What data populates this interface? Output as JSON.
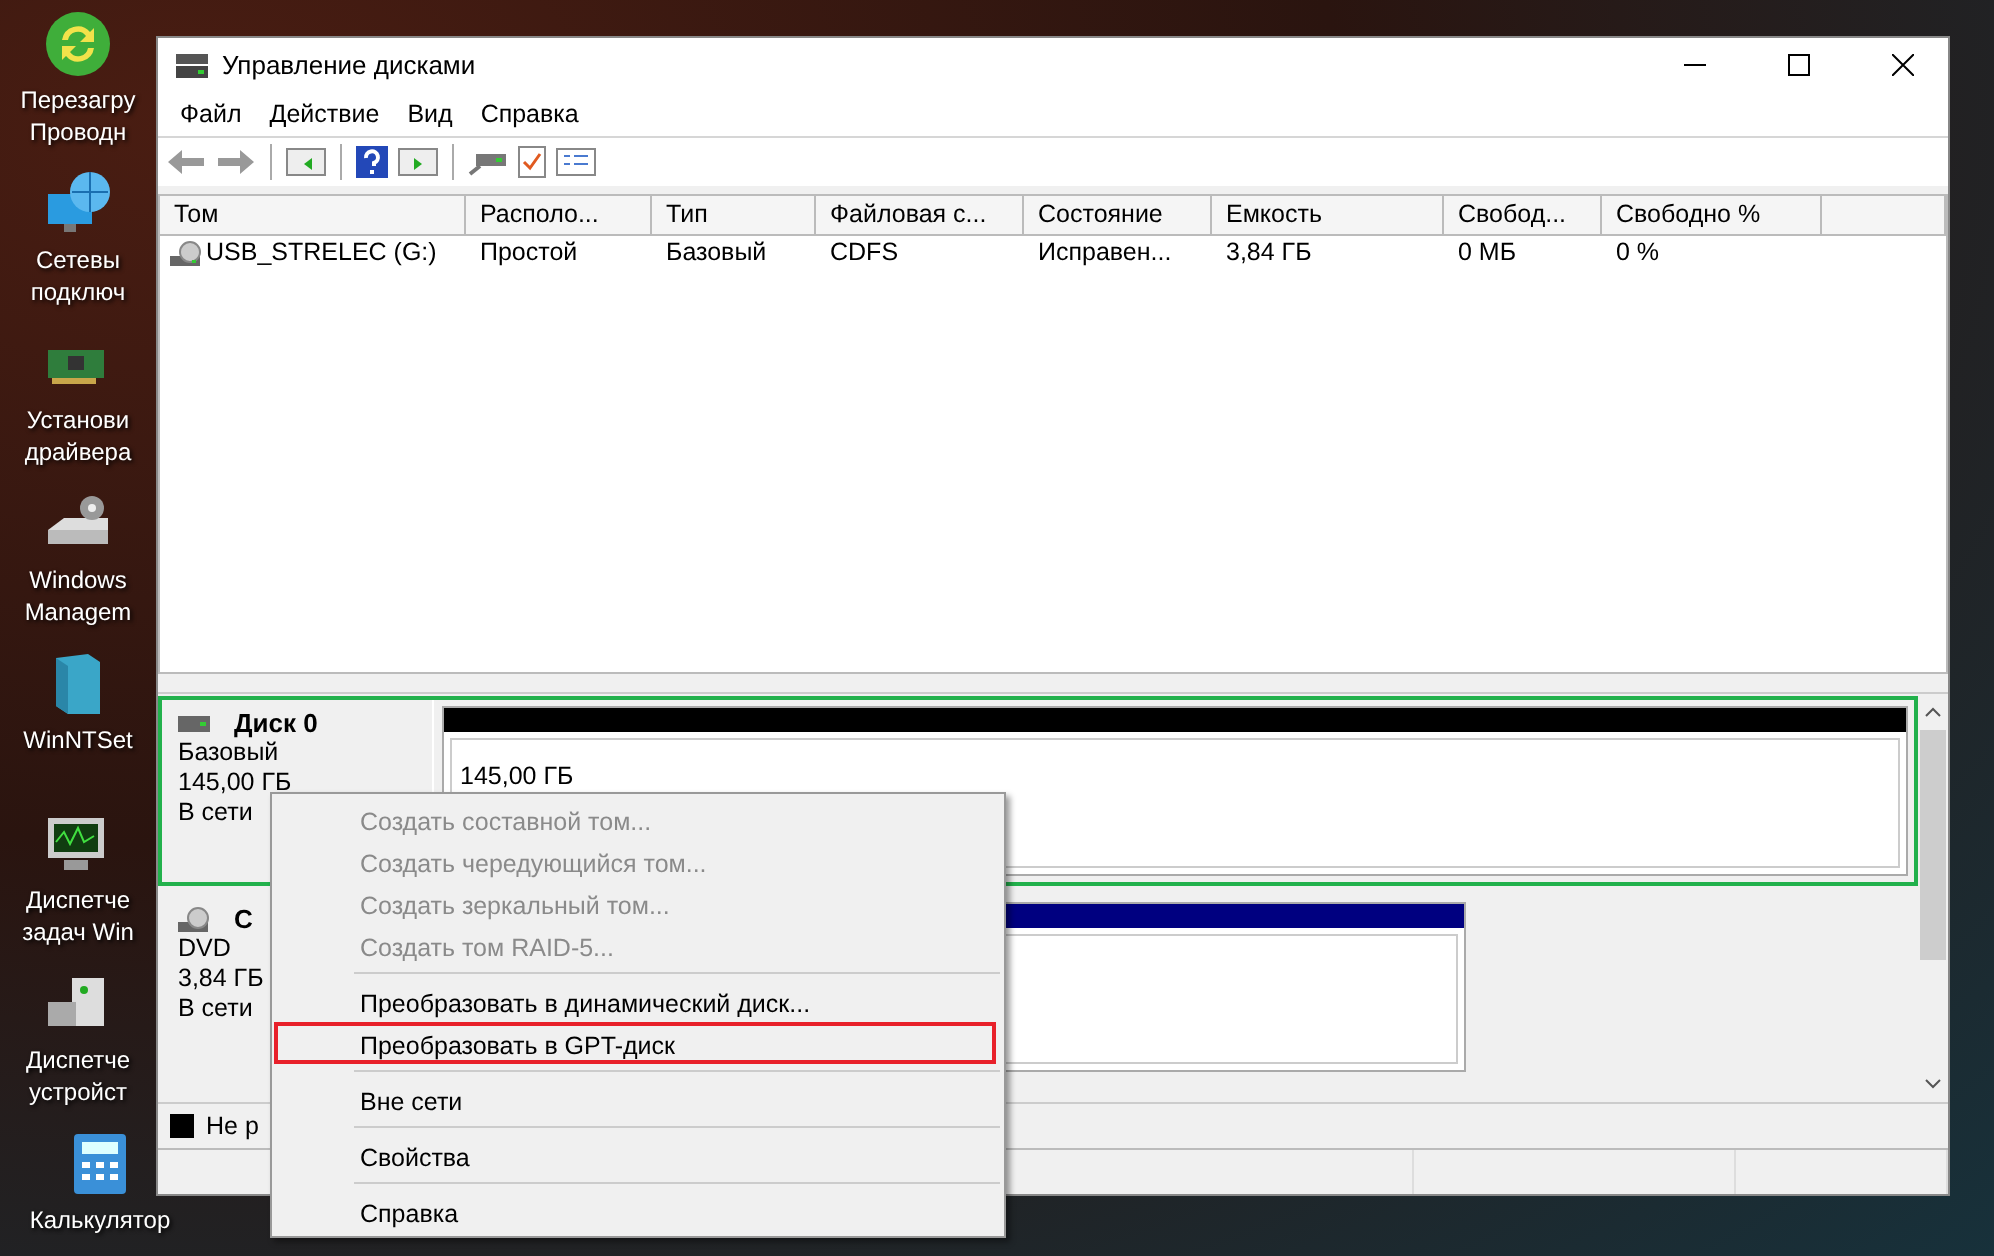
{
  "desktop_icons": [
    {
      "kind": "refresh",
      "label": "Перезагру\nПроводн"
    },
    {
      "kind": "network",
      "label": "Сетевы\nподключ"
    },
    {
      "kind": "board",
      "label": "Установи\nдрайвера"
    },
    {
      "kind": "drive",
      "label": "Windows\nManagem"
    },
    {
      "kind": "box",
      "label": "WinNTSet"
    },
    {
      "kind": "monitor",
      "label": "Диспетче\nзадач Win"
    },
    {
      "kind": "device",
      "label": "Диспетче\nустройст"
    },
    {
      "kind": "calc",
      "label": "Калькулятор"
    }
  ],
  "window": {
    "title": "Управление дисками"
  },
  "menu_bar": [
    "Файл",
    "Действие",
    "Вид",
    "Справка"
  ],
  "toolbar": [
    {
      "kind": "back"
    },
    {
      "kind": "forward"
    },
    {
      "kind": "sep"
    },
    {
      "kind": "panel"
    },
    {
      "kind": "sep"
    },
    {
      "kind": "help"
    },
    {
      "kind": "play"
    },
    {
      "kind": "sep"
    },
    {
      "kind": "connect"
    },
    {
      "kind": "check"
    },
    {
      "kind": "list"
    }
  ],
  "table": {
    "columns": [
      "Том",
      "Располо...",
      "Тип",
      "Файловая с...",
      "Состояние",
      "Емкость",
      "Свобод...",
      "Свободно %"
    ],
    "rows": [
      [
        "USB_STRELEC (G:)",
        "Простой",
        "Базовый",
        "CDFS",
        "Исправен...",
        "3,84 ГБ",
        "0 МБ",
        "0 %"
      ]
    ]
  },
  "disks": [
    {
      "kind": "hdd",
      "name": "Диск 0",
      "type": "Базовый",
      "size": "145,00 ГБ",
      "status": "В сети",
      "selected": true,
      "partition": {
        "color": "#000000",
        "label": "145,00 ГБ"
      }
    },
    {
      "kind": "cd",
      "name": "C",
      "type": "DVD",
      "size": "3,84 ГБ",
      "status": "В сети",
      "selected": false,
      "partition": {
        "color": "#000080"
      }
    }
  ],
  "legend": [
    {
      "color": "#000000",
      "label": "Не р"
    }
  ],
  "context_menu": [
    [
      {
        "label": "Создать составной том...",
        "disabled": true,
        "highlighted": false
      },
      {
        "label": "Создать чередующийся том...",
        "disabled": true,
        "highlighted": false
      },
      {
        "label": "Создать зеркальный том...",
        "disabled": true,
        "highlighted": false
      },
      {
        "label": "Создать том RAID-5...",
        "disabled": true,
        "highlighted": false
      }
    ],
    [
      {
        "label": "Преобразовать в динамический диск...",
        "disabled": false,
        "highlighted": false
      },
      {
        "label": "Преобразовать в GPT-диск",
        "disabled": false,
        "highlighted": true
      }
    ],
    [
      {
        "label": "Вне сети",
        "disabled": false,
        "highlighted": false
      }
    ],
    [
      {
        "label": "Свойства",
        "disabled": false,
        "highlighted": false
      }
    ],
    [
      {
        "label": "Справка",
        "disabled": false,
        "highlighted": false
      }
    ]
  ]
}
